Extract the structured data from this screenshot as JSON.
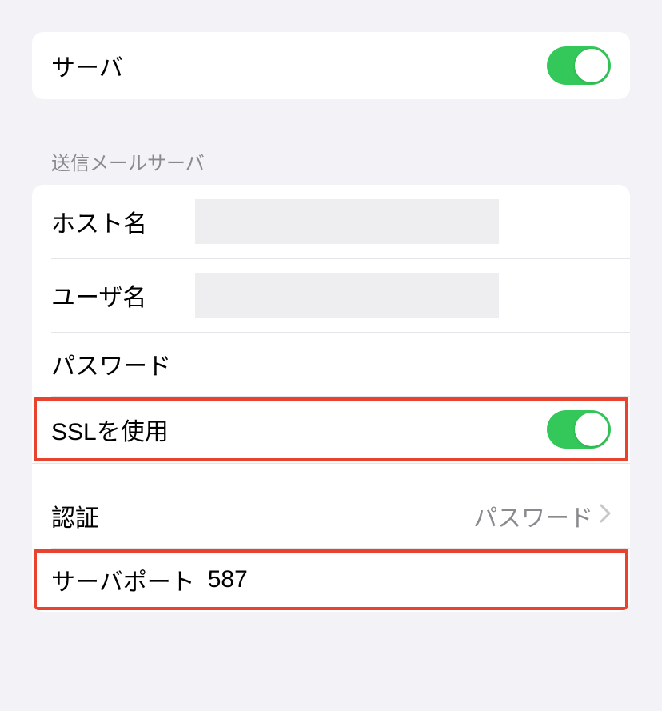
{
  "topSection": {
    "serverLabel": "サーバ",
    "serverEnabled": true
  },
  "outgoing": {
    "header": "送信メールサーバ",
    "rows": {
      "hostLabel": "ホスト名",
      "hostValue": "",
      "userLabel": "ユーザ名",
      "userValue": "",
      "passwordLabel": "パスワード",
      "sslLabel": "SSLを使用",
      "sslEnabled": true,
      "authLabel": "認証",
      "authValue": "パスワード",
      "portLabel": "サーバポート",
      "portValue": "587"
    }
  }
}
